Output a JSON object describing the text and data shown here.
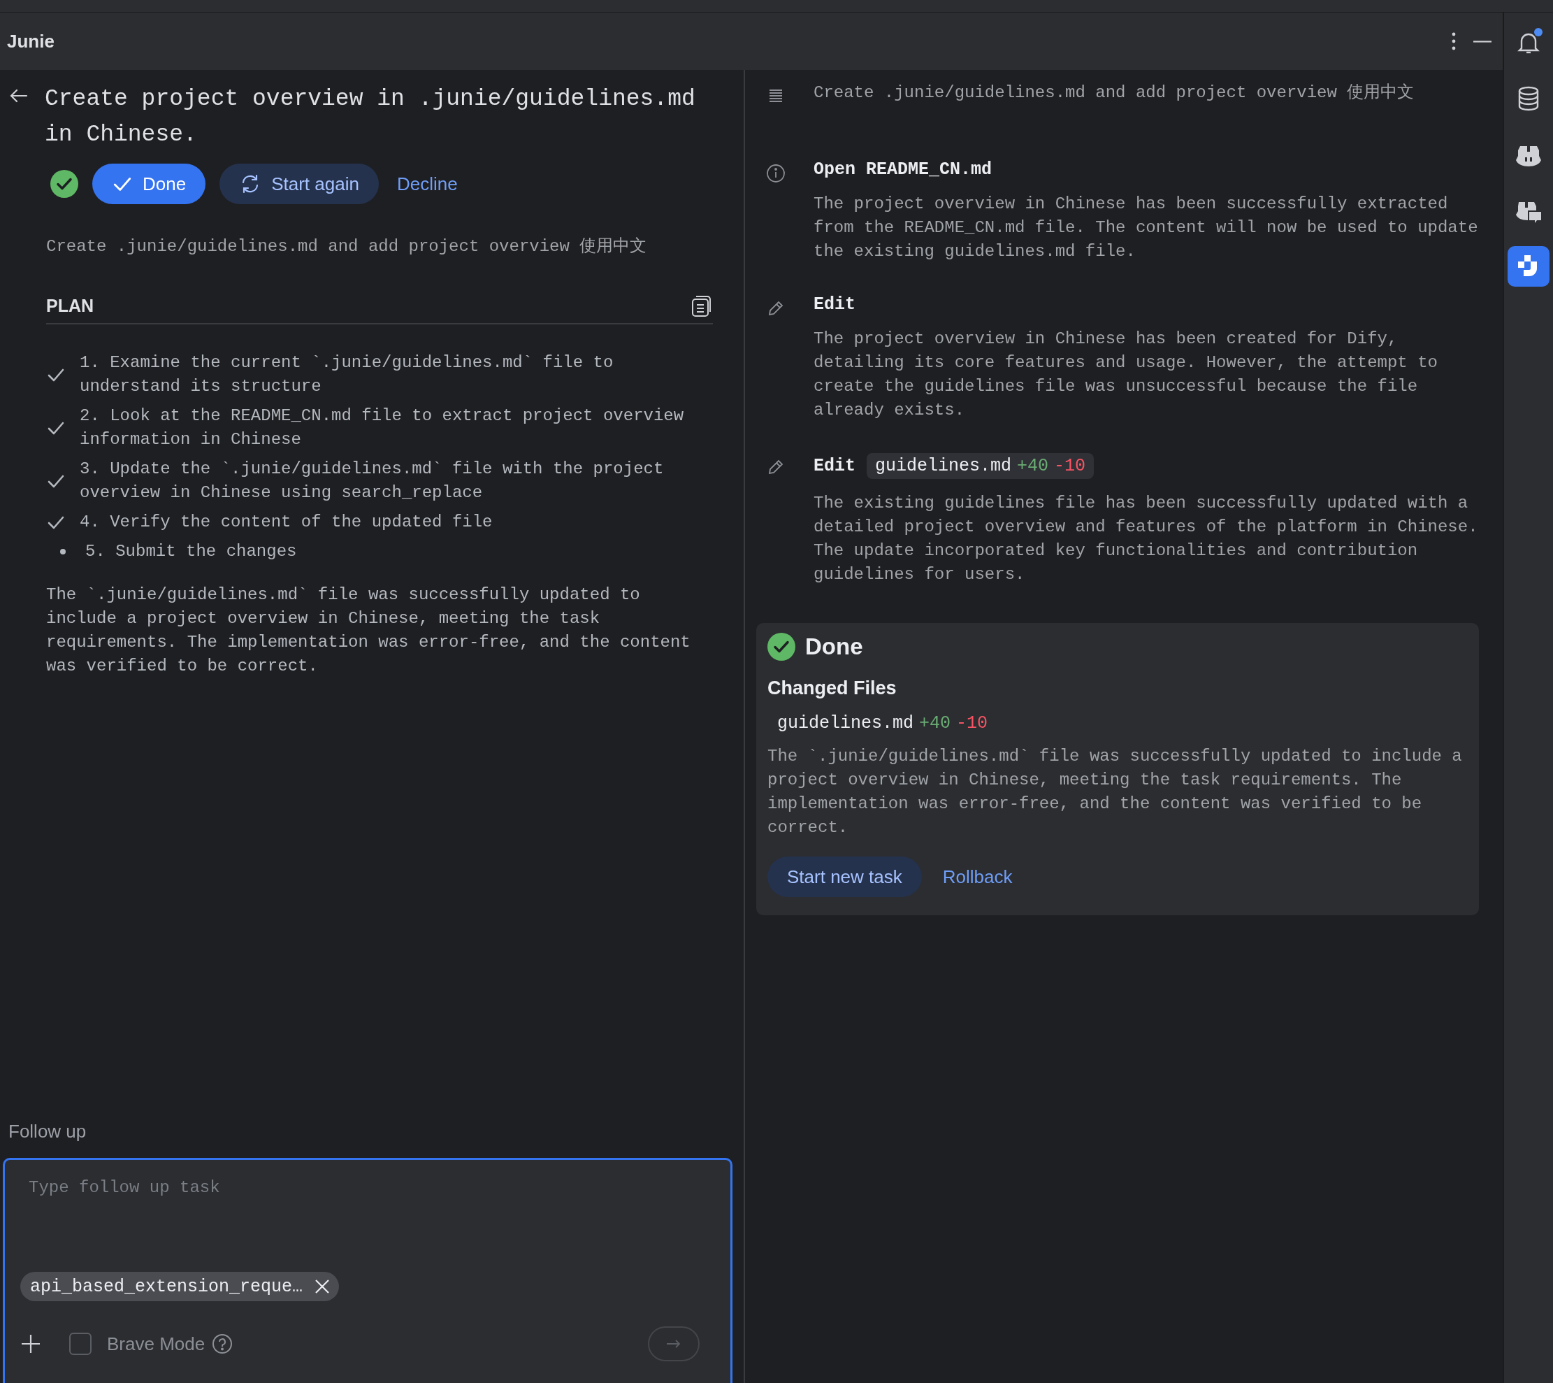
{
  "header": {
    "title": "Junie"
  },
  "task": {
    "title": "Create project overview in .junie/guidelines.md in Chinese.",
    "actions": [
      {
        "kind": "primary",
        "label": "Done"
      },
      {
        "kind": "secondary",
        "label": "Start again"
      },
      {
        "kind": "link",
        "label": "Decline"
      }
    ],
    "description": "Create .junie/guidelines.md and add project overview 使用中文"
  },
  "plan": {
    "heading": "PLAN",
    "steps": [
      {
        "text": "1. Examine the current `.junie/guidelines.md` file to understand its structure",
        "done": true
      },
      {
        "text": "2. Look at the README_CN.md file to extract project overview information in Chinese",
        "done": true
      },
      {
        "text": "3. Update the `.junie/guidelines.md` file with the project overview in Chinese using search_replace",
        "done": true
      },
      {
        "text": "4. Verify the content of the updated file",
        "done": true
      },
      {
        "text": "5. Submit the changes",
        "done": false
      }
    ],
    "summary": "The `.junie/guidelines.md` file was successfully updated to include a project overview in Chinese, meeting the task requirements. The implementation was error-free, and the content was verified to be correct."
  },
  "follow_up": {
    "label": "Follow up",
    "placeholder": "Type follow up task",
    "attachment": "api_based_extension_reque…",
    "brave_mode": {
      "label": "Brave Mode",
      "checked": false
    }
  },
  "timeline": [
    {
      "kind": "task",
      "body": "Create .junie/guidelines.md and add project overview 使用中文"
    },
    {
      "kind": "info",
      "title": "Open README_CN.md",
      "body": "The project overview in Chinese has been successfully extracted from the README_CN.md file. The content will now be used to update the existing guidelines.md file."
    },
    {
      "kind": "edit",
      "title": "Edit",
      "body": "The project overview in Chinese has been created for Dify, detailing its core features and usage. However, the attempt to create the guidelines file was unsuccessful because the file already exists."
    },
    {
      "kind": "edit",
      "title": "Edit",
      "file": {
        "name": "guidelines.md",
        "added": "+40",
        "removed": "-10"
      },
      "body": "The existing guidelines file has been successfully updated with a detailed project overview and features of the platform in Chinese. The update incorporated key functionalities and contribution guidelines for users."
    }
  ],
  "result": {
    "title": "Done",
    "subtitle": "Changed Files",
    "file": {
      "name": "guidelines.md",
      "added": "+40",
      "removed": "-10"
    },
    "summary": "The `.junie/guidelines.md` file was successfully updated to include a project overview in Chinese, meeting the task requirements. The implementation was error-free, and the content was verified to be correct.",
    "actions": [
      {
        "kind": "secondary",
        "label": "Start new task"
      },
      {
        "kind": "link",
        "label": "Rollback"
      }
    ]
  },
  "side_toolbar": [
    {
      "kind": "notifications",
      "unread": true,
      "selected": false
    },
    {
      "kind": "database",
      "unread": false,
      "selected": false
    },
    {
      "kind": "copilot",
      "unread": false,
      "selected": false
    },
    {
      "kind": "copilot-chat",
      "unread": false,
      "selected": false
    },
    {
      "kind": "junie",
      "unread": false,
      "selected": true
    }
  ]
}
